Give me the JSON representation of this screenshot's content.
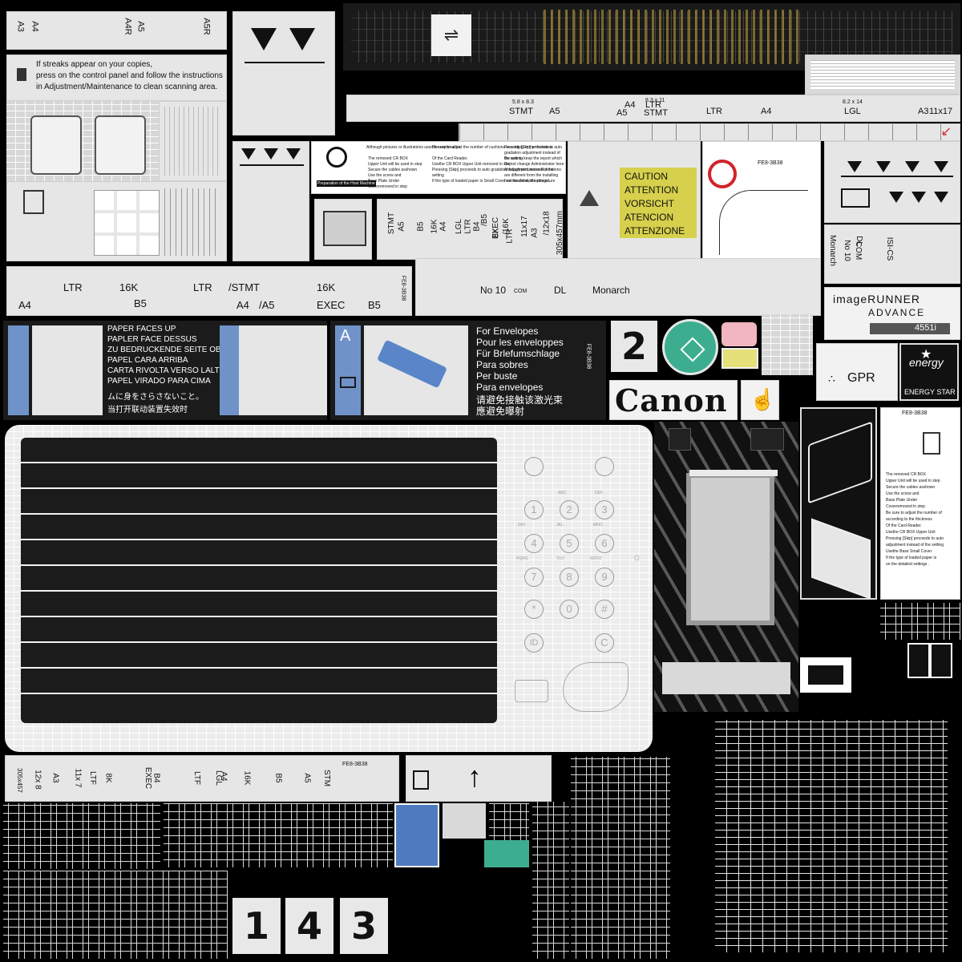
{
  "size_labels": {
    "top_left": [
      "A4",
      "A3",
      "A4R",
      "A5",
      "A5R"
    ],
    "paper_size_row": [
      "A4",
      "LTR",
      "16K",
      "B5",
      "LTR",
      "/STMT",
      "A4",
      "/A5",
      "16K",
      "EXEC",
      "B5"
    ],
    "envelope_row": [
      "No 10",
      "COM",
      "DL",
      "Monarch"
    ],
    "top_scale": [
      "STMT",
      "A5",
      "A4",
      "A5",
      "LTR",
      "STMT",
      "LTR",
      "A4",
      "LGL",
      "A3",
      "11x17"
    ],
    "top_scale_small": [
      "5.8 x 8.3",
      "8.3 x 11",
      "8.2 x 14"
    ],
    "vertical_sizes": [
      "STMT",
      "A5",
      "B5",
      "16K",
      "A4",
      "LGL",
      "LTR",
      "B4",
      "/B5",
      "EXEC",
      "8K",
      "/16K",
      "LTR",
      "11x17",
      "A3",
      "/12x18",
      "305x457mm"
    ],
    "right_vertical": [
      "Monarch",
      "No 10",
      "COM",
      "DL",
      "ISI-CS"
    ],
    "bottom_strip": [
      "305x457",
      "12x 8",
      "A3",
      "11x 7",
      "LTF",
      "8K",
      "EXEC",
      "B4",
      "LGL",
      "LTF",
      "A4",
      "16K",
      "B5",
      "A5",
      "STM"
    ]
  },
  "streaks_notice": {
    "lines": [
      "If streaks appear on your copies,",
      "press       on the control panel and follow the instructions",
      "in Adjustment/Maintenance to clean scanning area."
    ]
  },
  "paper_faces": {
    "lines": [
      "PAPER FACES UP",
      "PAPLER FACE DESSUS",
      "ZU BEDRUCKENDE SEITE OBEN",
      "PAPEL CARA ARRIBA",
      "CARTA RIVOLTA VERSO LALTO",
      "PAPEL VIRADO PARA CIMA",
      "ムに身をさらさないこと。",
      "当打开联动装置失效时"
    ]
  },
  "envelopes": {
    "badge": "A",
    "lines": [
      "For Envelopes",
      "Pour les enveloppes",
      "Für Brlefumschlage",
      "Para sobres",
      "Per buste",
      "Para envelopes",
      "请避免接触该激光束",
      "應避免曝射"
    ]
  },
  "caution": {
    "lines": [
      "CAUTION",
      "ATTENTION",
      "VORSICHT",
      "ATENCION",
      "ATTENZIONE"
    ]
  },
  "codes": {
    "fe8": "FE8-3B38"
  },
  "procedure_text": {
    "preparation": "Preparation of the Host Machine",
    "pictures_note": "Although pictures or illustrations used for explanation",
    "col1": [
      "The removed CR BOX",
      "Upper Unit will be used in step",
      "Secure the cables asshown",
      "Use the screw and",
      "Base Plate Under",
      "Coverremoved in step"
    ],
    "col2": [
      "Be sure to adjust the number of cushions according to the thickness",
      "Of the Card Reader.",
      "Usethe CR BOX Upper Unit removed in step",
      "Pressing [Skip] proceeds to auto gradation adjustment instead of the setting",
      "If the type of loaded paper is Small Cover on the detailed settings ."
    ],
    "col3": [
      "Pressing [Skip] proceeds to auto gradation adjustment instead of the setting",
      "Be sure to keep the report which",
      "Do not change Administrator here",
      "Although pictures or illustrations are different from the installing host machine, the procedure"
    ],
    "right_panel": [
      "The removed CR BOX",
      "Upper Unit will be used in step",
      "Secure the cables asshown",
      "Use the screw and",
      "Base Plate Under",
      "Coverremoved in step",
      "Be sure to adjust the number of",
      "according to the thickness",
      "Of the Card Reader.",
      "Usethe CR BOX Upper Unit",
      "Pressing [Skip] proceeds to auto",
      "adjustment instead of the setting",
      "Usethe Base Small Cover",
      "If the type of loaded paper is",
      "on the detailed settings ."
    ]
  },
  "branding": {
    "canon": "Canon",
    "product_line": "imageRUNNER",
    "advance": "ADVANCE",
    "model": "4551i",
    "gpr": "GPR",
    "energy_star": "ENERGY STAR",
    "energy_script": "energy"
  },
  "keypad": {
    "keys": [
      "1",
      "2",
      "3",
      "4",
      "5",
      "6",
      "7",
      "8",
      "9",
      "*",
      "0",
      "#"
    ],
    "letters": [
      "ABC",
      "DEF",
      "GHI",
      "JKL",
      "MNO",
      "PQRS",
      "TUV",
      "WXYZ"
    ],
    "id_key": "ID",
    "clear_key": "C"
  },
  "numbers": {
    "tray_2": "2",
    "trays": [
      "1",
      "4",
      "3"
    ]
  },
  "colors": {
    "label_bg": "#e6e6e6",
    "dark": "#1b1b1b",
    "accent_blue": "#6f93c9",
    "caution_yellow": "#d6d04c",
    "energy_green": "#3cae8f",
    "warning_red": "#d2232a"
  }
}
